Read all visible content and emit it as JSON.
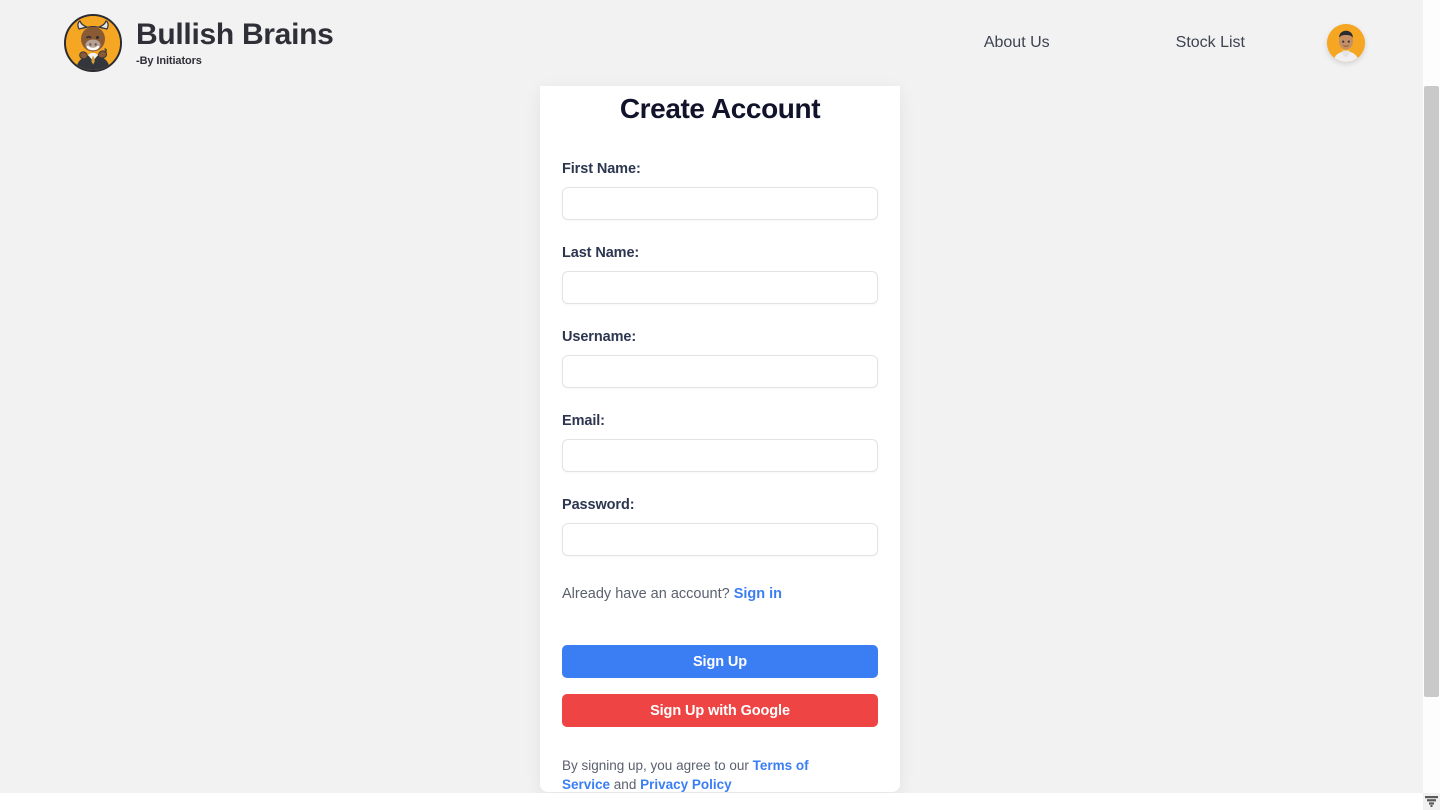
{
  "header": {
    "brand": {
      "title": "Bullish Brains",
      "subtitle": "-By Initiators",
      "logo_icon": "bull-mascot-icon",
      "logo_bg_color": "#f5a623"
    },
    "nav": [
      {
        "label": "About Us"
      },
      {
        "label": "Stock List"
      }
    ],
    "avatar": {
      "icon": "user-avatar-icon",
      "bg_color": "#f5a623"
    }
  },
  "form": {
    "title": "Create Account",
    "fields": [
      {
        "label": "First Name:",
        "value": "",
        "placeholder": "",
        "name": "first-name"
      },
      {
        "label": "Last Name:",
        "value": "",
        "placeholder": "",
        "name": "last-name"
      },
      {
        "label": "Username:",
        "value": "",
        "placeholder": "",
        "name": "username"
      },
      {
        "label": "Email:",
        "value": "",
        "placeholder": "",
        "name": "email"
      },
      {
        "label": "Password:",
        "value": "",
        "placeholder": "",
        "name": "password"
      }
    ],
    "signin": {
      "prompt": "Already have an account?",
      "link_label": "Sign in"
    },
    "buttons": {
      "primary": {
        "label": "Sign Up",
        "color": "#3b7ef4"
      },
      "google": {
        "label": "Sign Up with Google",
        "color": "#ef4444"
      }
    },
    "terms": {
      "prefix": "By signing up, you agree to our ",
      "terms_link": "Terms of Service",
      "middle": " and ",
      "privacy_link": "Privacy Policy"
    }
  },
  "colors": {
    "page_background": "#f3f2f2",
    "card_background": "#ffffff",
    "label_text": "#2d3650",
    "link_blue": "#3b7ef4",
    "google_red": "#ef4444",
    "scrollbar_thumb": "#c9c9c9"
  }
}
